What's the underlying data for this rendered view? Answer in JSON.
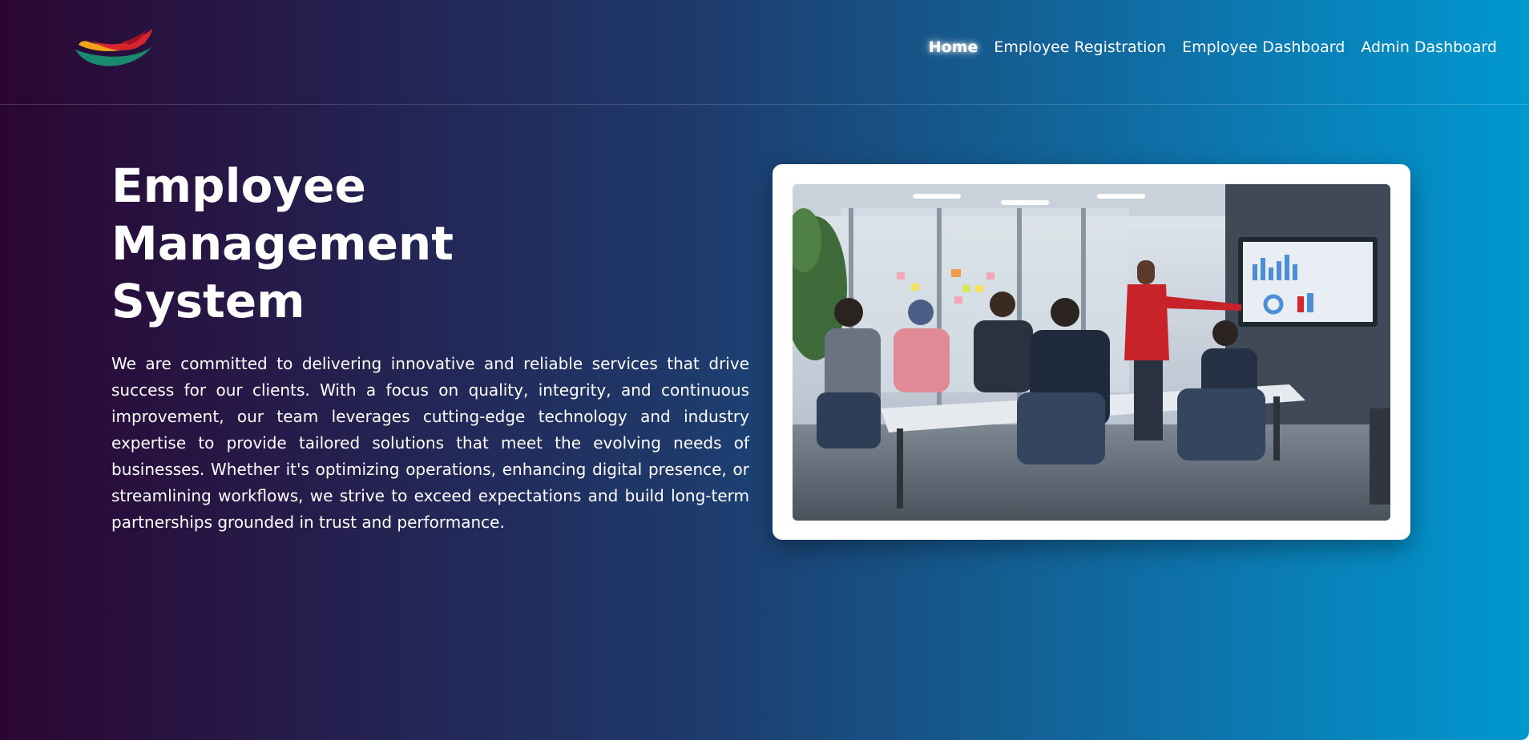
{
  "nav": {
    "items": [
      {
        "label": "Home",
        "active": true
      },
      {
        "label": "Employee Registration",
        "active": false
      },
      {
        "label": "Employee Dashboard",
        "active": false
      },
      {
        "label": "Admin Dashboard",
        "active": false
      }
    ]
  },
  "hero": {
    "title_lines": [
      "Employee",
      "Management",
      "System"
    ],
    "description": "We are committed to delivering innovative and reliable services that drive success for our clients. With a focus on quality, integrity, and continuous improvement, our team leverages cutting-edge technology and industry expertise to provide tailored solutions that meet the evolving needs of businesses. Whether it's optimizing operations, enhancing digital presence, or streamlining workflows, we strive to exceed expectations and build long-term partnerships grounded in trust and performance."
  },
  "colors": {
    "gradient_start": "#2b0633",
    "gradient_end": "#0098cf",
    "logo_red": "#d7262e",
    "logo_orange": "#f2a31b",
    "logo_green": "#1a8a6e",
    "presenter_jacket": "#c8232b"
  },
  "icons": {
    "logo": "brand-swoosh-logo"
  }
}
